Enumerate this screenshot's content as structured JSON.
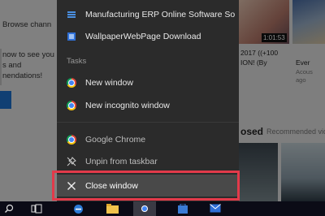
{
  "background_page": {
    "left_lines": [
      "Browse chann",
      "now to see you",
      "s and",
      "nendations!"
    ],
    "right": {
      "duration": "1:01:53",
      "title_lines": [
        "2017 ((+100",
        "ION! (By",
        "Ever",
        "Acous",
        "ago"
      ],
      "section_heading": "osed",
      "section_link": "Recommended vide"
    }
  },
  "jump_list": {
    "pinned": [
      {
        "label": "Manufacturing ERP Online Software So...",
        "icon": "list-icon"
      },
      {
        "label": "WallpaperWebPage Download",
        "icon": "page-icon"
      }
    ],
    "tasks_header": "Tasks",
    "tasks": [
      {
        "label": "New window",
        "icon": "chrome-icon"
      },
      {
        "label": "New incognito window",
        "icon": "chrome-icon"
      }
    ],
    "app": [
      {
        "label": "Google Chrome",
        "icon": "chrome-icon"
      },
      {
        "label": "Unpin from taskbar",
        "icon": "unpin-icon"
      }
    ],
    "close_label": "Close window"
  },
  "colors": {
    "highlight": "#e23a4a",
    "menu_bg": "#2b2b2b"
  },
  "taskbar": {
    "icons": [
      "search-icon",
      "task-view-icon",
      "edge-icon",
      "file-explorer-icon",
      "chrome-icon",
      "store-icon",
      "mail-icon"
    ]
  }
}
